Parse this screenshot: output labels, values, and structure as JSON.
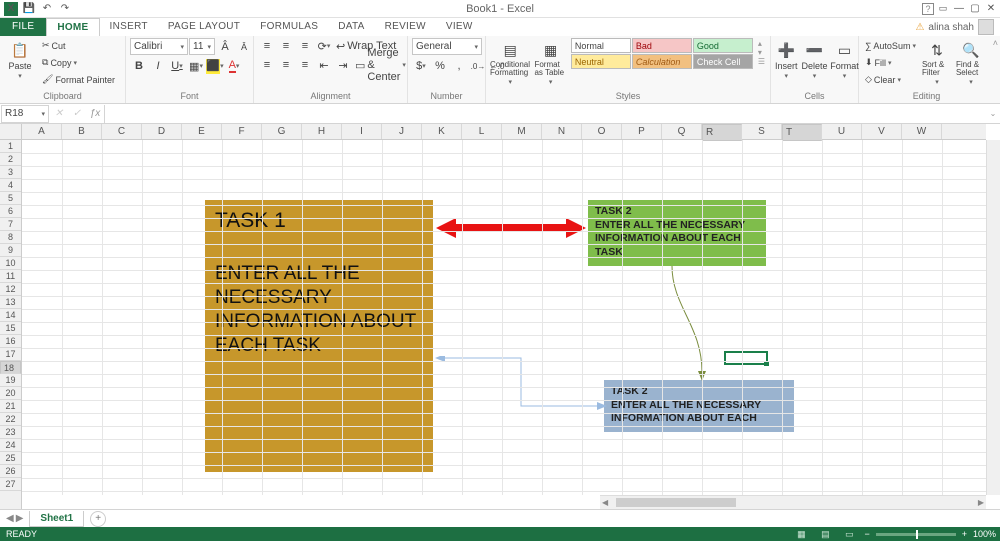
{
  "titlebar": {
    "doc_title": "Book1 - Excel"
  },
  "user": {
    "name": "alina shah"
  },
  "tabs": {
    "file": "FILE",
    "home": "HOME",
    "insert": "INSERT",
    "page_layout": "PAGE LAYOUT",
    "formulas": "FORMULAS",
    "data": "DATA",
    "review": "REVIEW",
    "view": "VIEW"
  },
  "clipboard": {
    "paste": "Paste",
    "cut": "Cut",
    "copy": "Copy",
    "format_painter": "Format Painter",
    "group": "Clipboard"
  },
  "font": {
    "name": "Calibri",
    "size": "11",
    "group": "Font"
  },
  "alignment": {
    "wrap": "Wrap Text",
    "merge": "Merge & Center",
    "group": "Alignment"
  },
  "number": {
    "format": "General",
    "group": "Number"
  },
  "styles": {
    "cond": "Conditional Formatting",
    "table": "Format as Table",
    "group": "Styles",
    "normal": "Normal",
    "bad": "Bad",
    "good": "Good",
    "neutral": "Neutral",
    "calc": "Calculation",
    "check": "Check Cell"
  },
  "cells": {
    "insert": "Insert",
    "delete": "Delete",
    "format": "Format",
    "group": "Cells"
  },
  "editing": {
    "autosum": "AutoSum",
    "fill": "Fill",
    "clear": "Clear",
    "sort": "Sort & Filter",
    "find": "Find & Select",
    "group": "Editing"
  },
  "namebox": "R18",
  "columns": [
    "A",
    "B",
    "C",
    "D",
    "E",
    "F",
    "G",
    "H",
    "I",
    "J",
    "K",
    "L",
    "M",
    "N",
    "O",
    "P",
    "Q",
    "R",
    "S",
    "T",
    "U",
    "V",
    "W"
  ],
  "rows_count": 27,
  "shapes": {
    "task1_title": "TASK 1",
    "task1_body": "ENTER ALL THE NECESSARY INFORMATION ABOUT  EACH TASK",
    "task2a_title": "TASK 2",
    "task2a_body": "ENTER ALL THE NECESSARY INFORMATION ABOUT  EACH TASK",
    "task2b_title": "TASK 2",
    "task2b_body": "ENTER ALL THE NECESSARY INFORMATION ABOUT  EACH"
  },
  "sheet": {
    "name": "Sheet1"
  },
  "status": {
    "ready": "READY",
    "zoom": "100%"
  }
}
